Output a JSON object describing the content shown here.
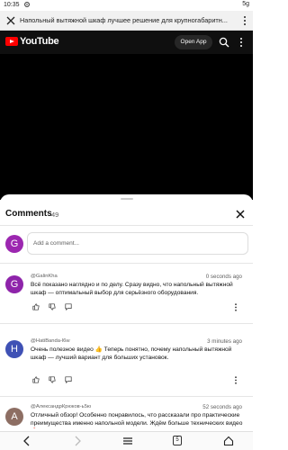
{
  "status_bar": {
    "time": "10:35",
    "right": "5g"
  },
  "url_bar": {
    "title": "Напольный вытяжной шкаф лучшее решение для крупногабаритн..."
  },
  "youtube": {
    "brand": "YouTube",
    "open_app_label": "Open App"
  },
  "comments": {
    "title": "Comments",
    "count": "49",
    "add_placeholder": "Add a comment...",
    "user_avatar_letter": "G",
    "user_avatar_color": "#9c27b0",
    "items": [
      {
        "avatar_letter": "G",
        "avatar_color": "#8e24aa",
        "author": "@GalinKha",
        "time": "0 seconds ago",
        "text": "Всё показано наглядно и по делу. Сразу видно, что напольный вытяжной шкаф — оптимальный выбор для серьёзного оборудования."
      },
      {
        "avatar_letter": "H",
        "avatar_color": "#3f51b5",
        "author": "@HatiBanda-l6w",
        "time": "3 minutes ago",
        "text": "Очень полезное видео 👍 Теперь понятно, почему напольный вытяжной шкаф — лучший вариант для больших установок."
      },
      {
        "avatar_letter": "A",
        "avatar_color": "#8d6e63",
        "author": "@АлександрКрюков-ь5ю",
        "time": "52 seconds ago",
        "text": "Отличный обзор! Особенно понравилось, что рассказали про практические преимущества именно напольной модели. Ждём больше технических видео 🔥"
      }
    ]
  },
  "bottom_nav": {
    "tab_count": "5"
  }
}
